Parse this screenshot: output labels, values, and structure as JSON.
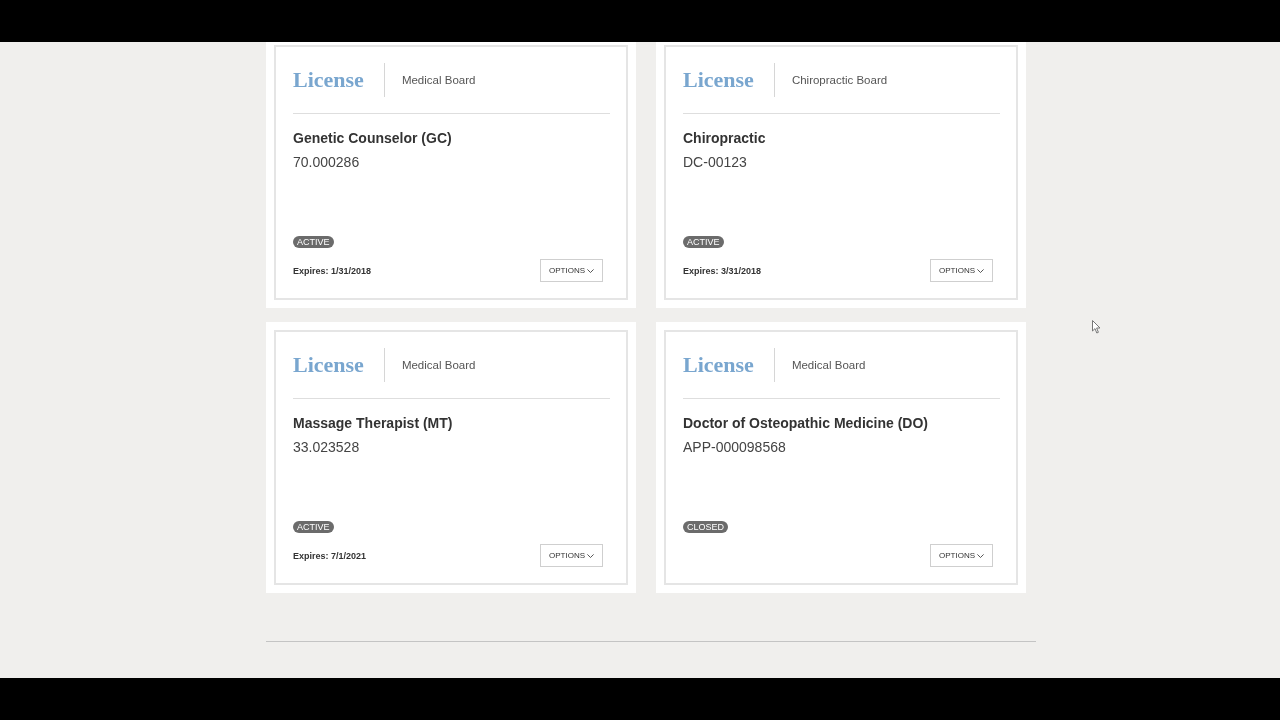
{
  "licenses": [
    {
      "logo": "License",
      "board": "Medical Board",
      "title": "Genetic Counselor (GC)",
      "number": "70.000286",
      "status": "ACTIVE",
      "expires": "Expires: 1/31/2018",
      "options": "OPTIONS"
    },
    {
      "logo": "License",
      "board": "Chiropractic Board",
      "title": "Chiropractic",
      "number": "DC-00123",
      "status": "ACTIVE",
      "expires": "Expires: 3/31/2018",
      "options": "OPTIONS"
    },
    {
      "logo": "License",
      "board": "Medical Board",
      "title": "Massage Therapist (MT)",
      "number": "33.023528",
      "status": "ACTIVE",
      "expires": "Expires: 7/1/2021",
      "options": "OPTIONS"
    },
    {
      "logo": "License",
      "board": "Medical Board",
      "title": "Doctor of Osteopathic Medicine (DO)",
      "number": "APP-000098568",
      "status": "CLOSED",
      "options": "OPTIONS"
    }
  ]
}
